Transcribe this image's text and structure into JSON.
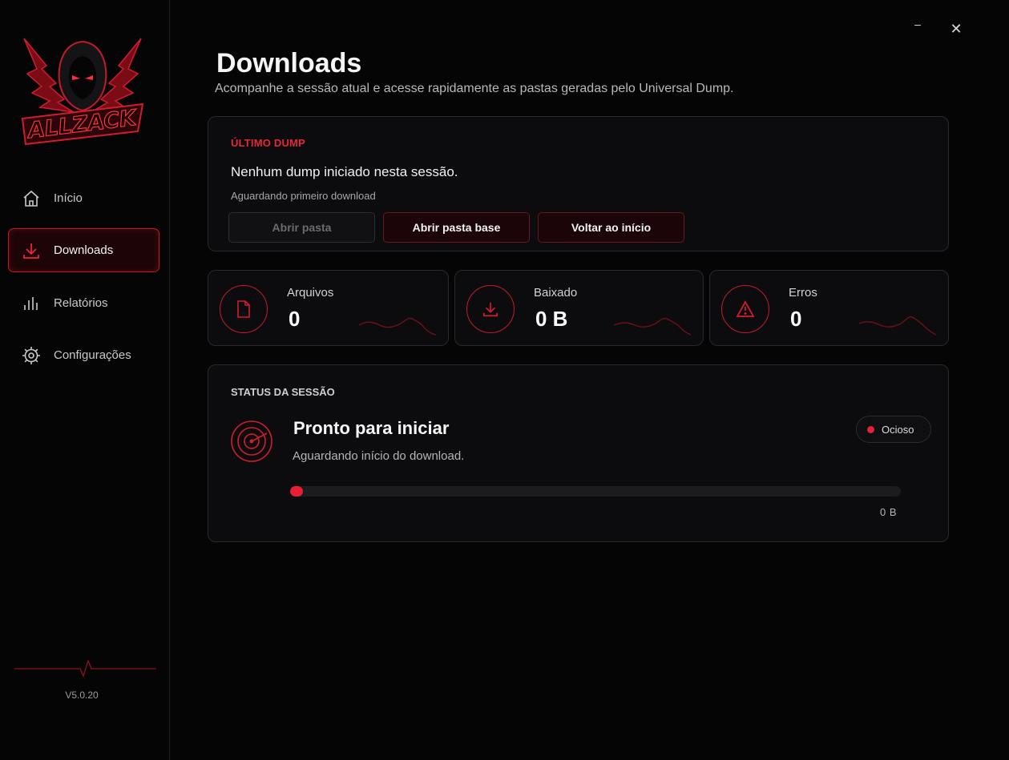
{
  "app": {
    "logo_text": "ALLZACK",
    "version": "V5.0.20",
    "accent": "#e81f33"
  },
  "window": {
    "minimize_label": "–",
    "close_label": "✕"
  },
  "sidebar": {
    "items": [
      {
        "label": "Início",
        "icon": "home-icon",
        "active": false
      },
      {
        "label": "Downloads",
        "icon": "download-icon",
        "active": true
      },
      {
        "label": "Relatórios",
        "icon": "bar-chart-icon",
        "active": false
      },
      {
        "label": "Configurações",
        "icon": "gear-icon",
        "active": false
      }
    ]
  },
  "header": {
    "title": "Downloads",
    "subtitle": "Acompanhe a sessão atual e acesse rapidamente as pastas geradas pelo Universal Dump."
  },
  "last_dump": {
    "label": "ÚLTIMO DUMP",
    "message": "Nenhum dump iniciado nesta sessão.",
    "detail": "Aguardando primeiro download",
    "buttons": {
      "open_folder": "Abrir pasta",
      "open_base_folder": "Abrir pasta base",
      "back_home": "Voltar ao início"
    }
  },
  "stats": [
    {
      "label": "Arquivos",
      "value": "0",
      "icon": "file-icon"
    },
    {
      "label": "Baixado",
      "value": "0 B",
      "icon": "download-icon"
    },
    {
      "label": "Erros",
      "value": "0",
      "icon": "warning-icon"
    }
  ],
  "session_status": {
    "label": "STATUS DA SESSÃO",
    "title": "Pronto para iniciar",
    "subtitle": "Aguardando início do download.",
    "badge": "Ocioso",
    "progress_fraction": 0,
    "progress_text": "0 B"
  }
}
